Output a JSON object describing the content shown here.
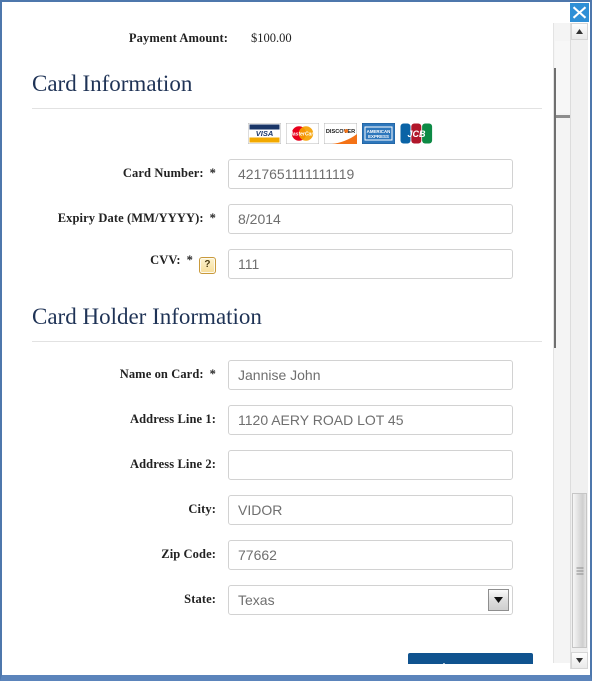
{
  "window": {
    "close_label": "×",
    "accent_color": "#4d77ac",
    "close_button_color": "#2e8fd6"
  },
  "payment": {
    "amount_label": "Payment Amount:",
    "amount_value": "$100.00"
  },
  "card_section": {
    "title": "Card Information",
    "accepted_cards": [
      {
        "name": "visa",
        "text": "VISA"
      },
      {
        "name": "mastercard",
        "text": "MasterCard"
      },
      {
        "name": "discover",
        "text": "DISCOVER"
      },
      {
        "name": "american-express",
        "text": "AMERICAN EXPRESS"
      },
      {
        "name": "jcb",
        "text": "JCB"
      }
    ],
    "fields": [
      {
        "label": "Card Number:",
        "required": "*",
        "value": "4217651111111119",
        "placeholder": ""
      },
      {
        "label": "Expiry Date (MM/YYYY):",
        "required": "*",
        "value": "8/2014",
        "placeholder": ""
      },
      {
        "label": "CVV:",
        "required": "*",
        "help": "?",
        "value": "111",
        "placeholder": ""
      }
    ]
  },
  "holder_section": {
    "title": "Card Holder Information",
    "fields": [
      {
        "label": "Name on Card:",
        "required": "*",
        "value": "Jannise John",
        "placeholder": ""
      },
      {
        "label": "Address Line 1:",
        "required": "",
        "value": "1120 AERY ROAD LOT 45",
        "placeholder": ""
      },
      {
        "label": "Address Line 2:",
        "required": "",
        "value": "",
        "placeholder": ""
      },
      {
        "label": "City:",
        "required": "",
        "value": "VIDOR",
        "placeholder": ""
      },
      {
        "label": "Zip Code:",
        "required": "",
        "value": "77662",
        "placeholder": ""
      }
    ],
    "state_field": {
      "label": "State:",
      "required": "",
      "selected": "Texas"
    }
  },
  "actions": {
    "submit_label": "Make Payment",
    "submit_color": "#10538f"
  }
}
